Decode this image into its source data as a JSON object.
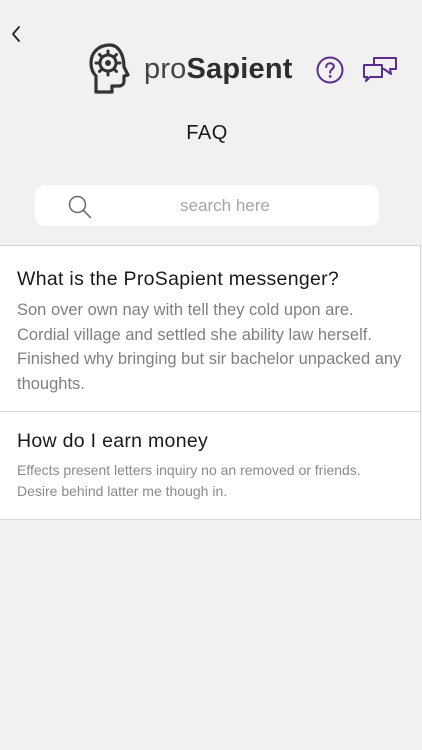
{
  "header": {
    "back_icon": "chevron-left-icon",
    "logo_mark_icon": "head-gear-icon",
    "logo_text_light": "pro",
    "logo_text_bold": "Sapient",
    "help_icon": "question-circle-icon",
    "chat_icon": "chat-bubbles-icon",
    "accent_color": "#5b2d8e"
  },
  "page": {
    "title": "FAQ"
  },
  "search": {
    "icon": "search-icon",
    "placeholder": "search here",
    "value": ""
  },
  "faq": [
    {
      "question": "What is the ProSapient messenger?",
      "answer": "Son over own nay with tell they cold upon are. Cordial village and settled she ability law herself. Finished why bringing but sir bachelor unpacked any thoughts."
    },
    {
      "question": "How do I earn money",
      "answer": "Effects present letters inquiry no an removed or friends. Desire behind latter me though in."
    }
  ]
}
